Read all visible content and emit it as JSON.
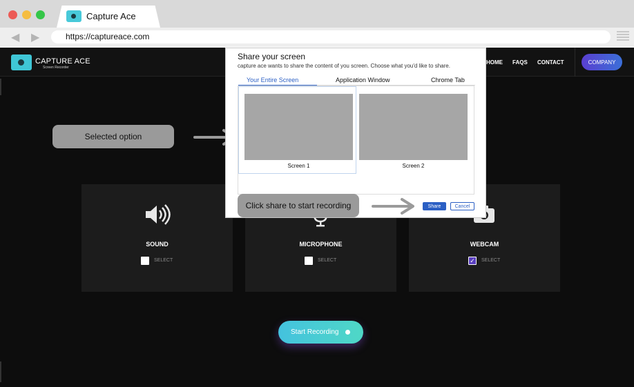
{
  "browser": {
    "tab_title": "Capture Ace",
    "url": "https://captureace.com",
    "back_icon": "back-arrow-icon",
    "forward_icon": "forward-arrow-icon",
    "menu_icon": "hamburger-menu-icon",
    "traffic_colors": [
      "#ec5b56",
      "#f5bd40",
      "#35c648"
    ]
  },
  "site": {
    "logo_name": "CAPTURE ACE",
    "logo_sub": "Screen Recorder",
    "nav": [
      "HOME",
      "FAQS",
      "CONTACT"
    ],
    "company_label": "COMPANY"
  },
  "options": [
    {
      "title": "SOUND",
      "select_label": "SELECT",
      "checked": false,
      "icon": "speaker-icon"
    },
    {
      "title": "MICROPHONE",
      "select_label": "SELECT",
      "checked": false,
      "icon": "microphone-icon"
    },
    {
      "title": "WEBCAM",
      "select_label": "SELECT",
      "checked": true,
      "icon": "camera-icon"
    }
  ],
  "start_label": "Start Recording",
  "annotations": {
    "selected_option": "Selected option",
    "click_share": "Click share to start recording"
  },
  "dialog": {
    "title": "Share your screen",
    "subtitle": "capture ace wants to share the content of you screen. Choose what you'd like to share.",
    "tabs": [
      "Your Entire Screen",
      "Application Window",
      "Chrome Tab"
    ],
    "active_tab": 0,
    "screens": [
      "Screen 1",
      "Screen 2"
    ],
    "share_label": "Share",
    "cancel_label": "Cancel"
  },
  "colors": {
    "accent_blue": "#2b5fc4",
    "brand_teal": "#3fc6d6",
    "company_gradient": [
      "#5a3fd0",
      "#3b6fd8"
    ],
    "page_bg": "#0d0d0d",
    "card_bg": "#1c1c1c"
  }
}
